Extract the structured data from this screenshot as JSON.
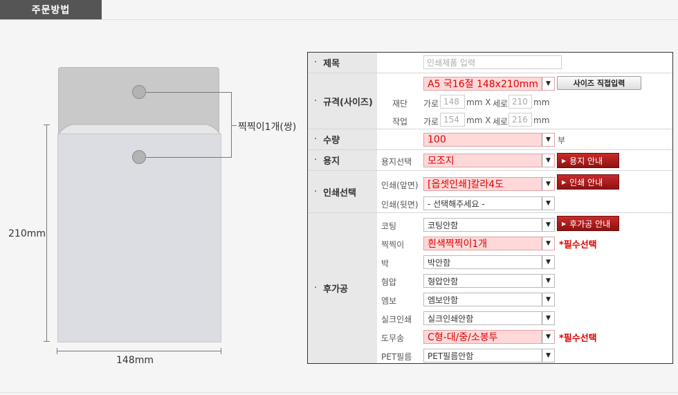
{
  "section_title": "주문방법",
  "illustration": {
    "leader_label": "찍찍이1개(쌍)",
    "height_label": "210mm",
    "width_label": "148mm"
  },
  "form": {
    "title": {
      "label": "제목",
      "placeholder": "인쇄제품 입력"
    },
    "size": {
      "label": "규격(사이즈)",
      "selected": "A5 국16절 148x210mm",
      "custom_button": "사이즈 직접입력",
      "cut": {
        "label": "재단",
        "w_label": "가로",
        "w": "148",
        "mm1": "mm X",
        "h_label": "세로",
        "h": "210",
        "mm2": "mm"
      },
      "work": {
        "label": "작업",
        "w_label": "가로",
        "w": "154",
        "mm1": "mm X",
        "h_label": "세로",
        "h": "216",
        "mm2": "mm"
      }
    },
    "quantity": {
      "label": "수량",
      "selected": "100",
      "unit": "부"
    },
    "paper": {
      "label": "용지",
      "sub_label": "용지선택",
      "selected": "모조지",
      "guide": "용지 안내"
    },
    "print": {
      "label": "인쇄선택",
      "front_label": "인쇄(앞면)",
      "front_selected": "[옵셋인쇄]칼라4도",
      "guide": "인쇄 안내",
      "back_label": "인쇄(뒷면)",
      "back_selected": "- 선택해주세요 -"
    },
    "post": {
      "label": "후가공",
      "guide": "후가공 안내",
      "required_text": "*필수선택",
      "items": [
        {
          "label": "코팅",
          "selected": "코팅안함"
        },
        {
          "label": "찍찍이",
          "selected": "흰색찍찍이1개"
        },
        {
          "label": "박",
          "selected": "박안함"
        },
        {
          "label": "형압",
          "selected": "형압안함"
        },
        {
          "label": "엠보",
          "selected": "엠보안함"
        },
        {
          "label": "실크인쇄",
          "selected": "실크인쇄안함"
        },
        {
          "label": "도무송",
          "selected": "C형-대/중/소봉투"
        },
        {
          "label": "PET필름",
          "selected": "PET필름안함"
        }
      ]
    }
  },
  "bullet": "·",
  "arrow_glyph": "▼",
  "tri_glyph": "▶",
  "colors": {
    "accent_red": "#e00000",
    "highlight": "#ffd9d9",
    "tab": "#555555"
  }
}
